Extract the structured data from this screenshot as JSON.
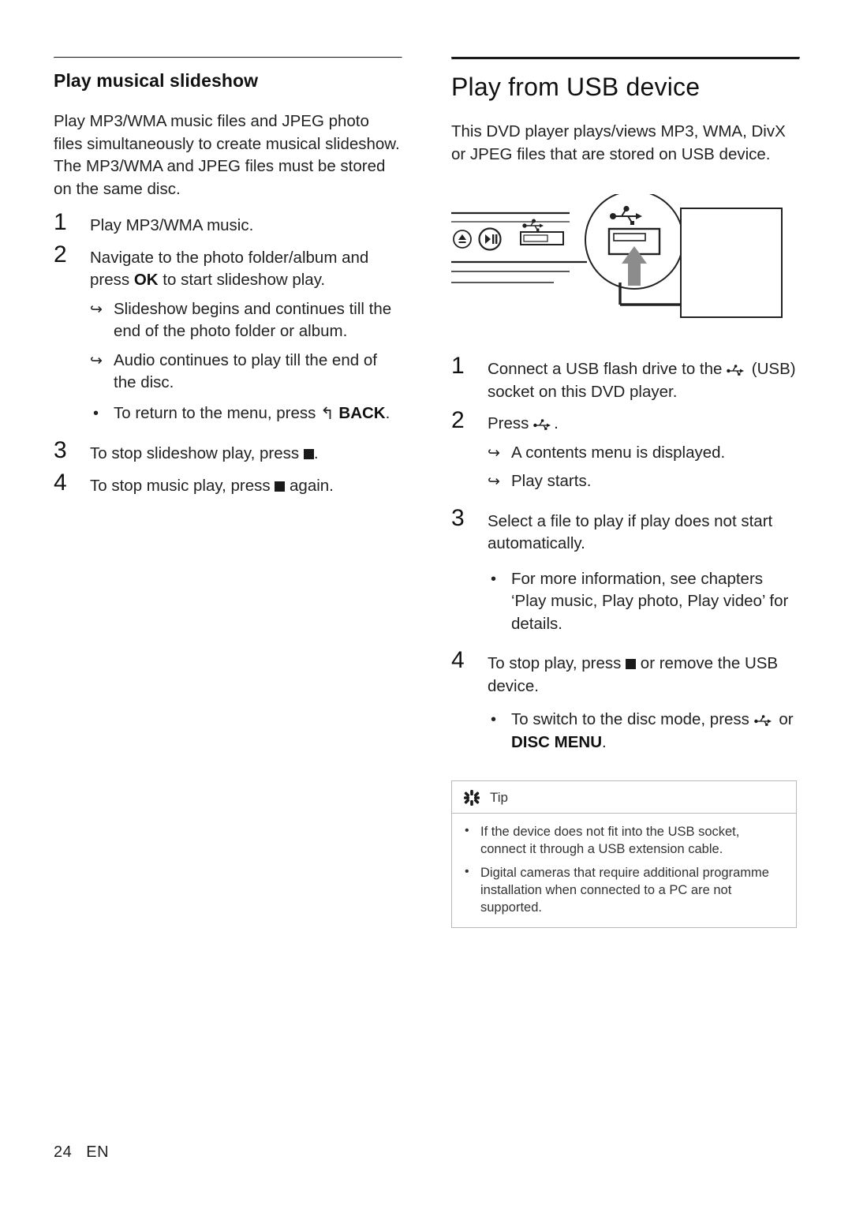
{
  "left_column": {
    "section_title": "Play musical slideshow",
    "intro": "Play MP3/WMA music files and JPEG photo files simultaneously to create musical slideshow. The MP3/WMA and JPEG files must be stored on the same disc.",
    "steps": [
      {
        "num": "1",
        "text": "Play MP3/WMA music."
      },
      {
        "num": "2",
        "text_before": "Navigate to the photo folder/album and press ",
        "bold": "OK",
        "text_after": " to start slideshow play."
      },
      {
        "num": "3",
        "text_before": "To stop slideshow play, press ",
        "text_after": "."
      },
      {
        "num": "4",
        "text_before": "To stop music play, press ",
        "text_after": " again."
      }
    ],
    "sub_items": [
      {
        "marker": "arrow",
        "text": "Slideshow begins and continues till the end of the photo folder or album."
      },
      {
        "marker": "arrow",
        "text": "Audio continues to play till the end of the disc."
      },
      {
        "marker": "bullet",
        "text_before": "To return to the menu, press ",
        "bold": "BACK",
        "text_after": "."
      }
    ]
  },
  "right_column": {
    "section_title": "Play from USB device",
    "intro": "This DVD player plays/views MP3, WMA, DivX or JPEG files that are stored on USB device.",
    "steps": [
      {
        "num": "1",
        "text_before": "Connect a USB flash drive to the ",
        "text_after": " (USB) socket on this DVD player."
      },
      {
        "num": "2",
        "text_before": "Press ",
        "text_after": "."
      },
      {
        "num": "3",
        "text": "Select a file to play if play does not start automatically."
      },
      {
        "num": "4",
        "text_before": "To stop play, press ",
        "text_after": " or remove the USB device."
      }
    ],
    "step2_sub": [
      {
        "marker": "arrow",
        "text": "A contents menu is displayed."
      },
      {
        "marker": "arrow",
        "text": "Play starts."
      }
    ],
    "step3_sub": [
      {
        "marker": "bullet",
        "text": "For more information, see chapters ‘Play music, Play photo, Play video’ for details."
      }
    ],
    "step4_sub": [
      {
        "marker": "bullet",
        "text_before": "To switch to the disc mode, press ",
        "text_after": " or ",
        "bold": "DISC MENU",
        "text_end": "."
      }
    ],
    "tip": {
      "label": "Tip",
      "items": [
        "If the device does not fit into the USB socket, connect it through a USB extension cable.",
        "Digital cameras that require additional programme installation when connected to a PC are not supported."
      ]
    }
  },
  "footer": {
    "page_number": "24",
    "language": "EN"
  },
  "colors": {
    "text": "#1a1a1a",
    "rule": "#1a1a1a",
    "tip_border": "#b9b9b9",
    "illustration_line": "#222222",
    "illustration_arrow": "#8c8c8c"
  }
}
